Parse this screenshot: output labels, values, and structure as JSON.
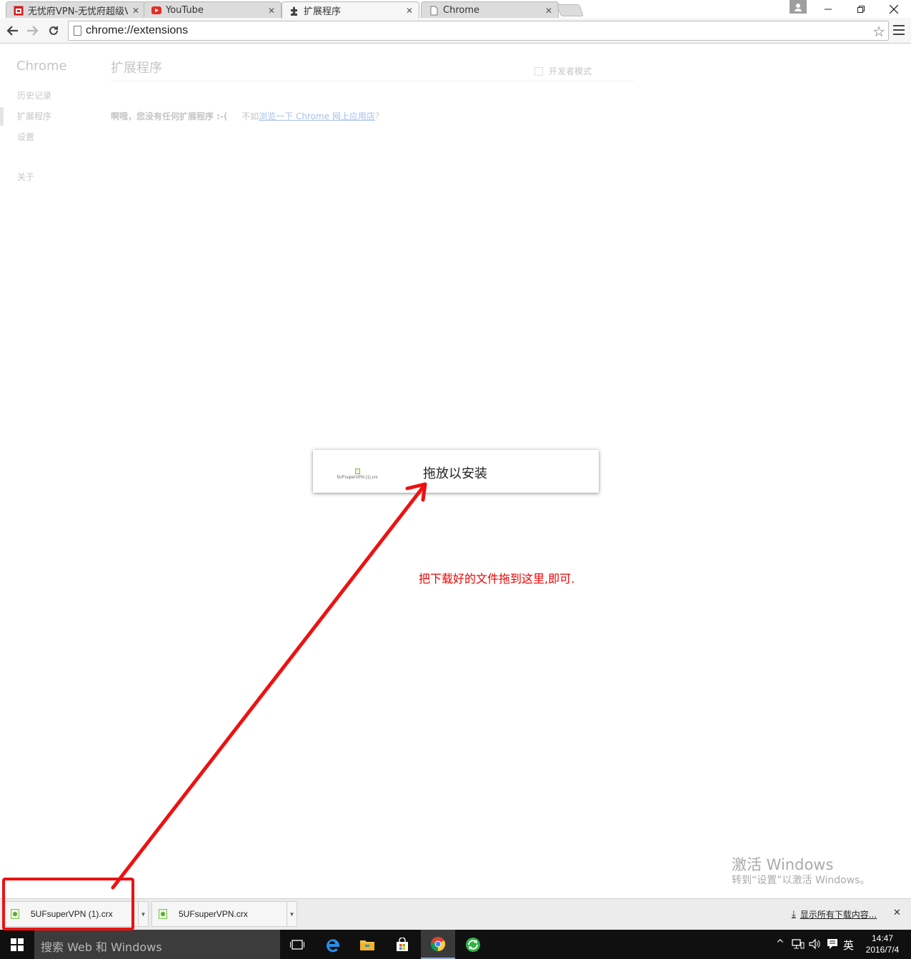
{
  "tabs": [
    {
      "title": "无忧府VPN-无忧府超级VI",
      "icon": "vpn-site-icon"
    },
    {
      "title": "YouTube",
      "icon": "youtube-icon"
    },
    {
      "title": "扩展程序",
      "icon": "puzzle-piece-icon",
      "active": true
    },
    {
      "title": "Chrome",
      "icon": "page-icon"
    }
  ],
  "omnibox": {
    "url": "chrome://extensions"
  },
  "sidebar": {
    "brand": "Chrome",
    "items": [
      {
        "label": "历史记录"
      },
      {
        "label": "扩展程序",
        "selected": true
      },
      {
        "label": "设置"
      },
      {
        "label": "关于"
      }
    ]
  },
  "extensions": {
    "title": "扩展程序",
    "dev_mode_label": "开发者模式",
    "empty_message": "啊哦，您没有任何扩展程序 :-(",
    "suggestion_prefix": "不如",
    "store_link": "浏览一下 Chrome 网上应用店",
    "suggestion_suffix": "？"
  },
  "drop_overlay": {
    "label": "拖放以安装",
    "file_name": "5UFsuperVPN (1).crx"
  },
  "annotation": {
    "text": "把下载好的文件拖到这里,即可.",
    "color": "#ee0000"
  },
  "watermark": {
    "line1": "激活 Windows",
    "line2": "转到“设置”以激活 Windows。"
  },
  "download_shelf": {
    "items": [
      {
        "file_name": "5UFsuperVPN (1).crx"
      },
      {
        "file_name": "5UFsuperVPN.crx"
      }
    ],
    "show_all_label": "显示所有下载内容..."
  },
  "taskbar": {
    "search_placeholder": "搜索 Web 和 Windows",
    "apps": [
      "task-view-icon",
      "edge-icon",
      "file-explorer-icon",
      "store-icon",
      "chrome-icon",
      "vpn-app-icon"
    ],
    "ime_label": "英",
    "time": "14:47",
    "date": "2016/7/4"
  }
}
